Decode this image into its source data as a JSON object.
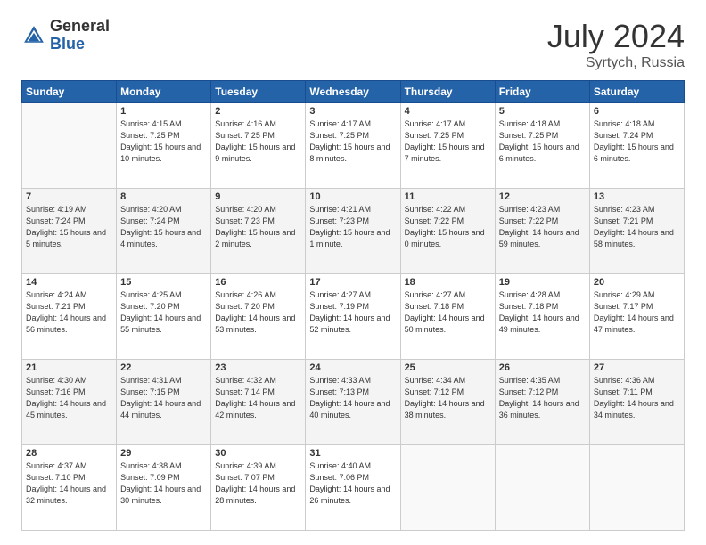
{
  "header": {
    "logo_general": "General",
    "logo_blue": "Blue",
    "title": "July 2024",
    "location": "Syrtych, Russia"
  },
  "days_of_week": [
    "Sunday",
    "Monday",
    "Tuesday",
    "Wednesday",
    "Thursday",
    "Friday",
    "Saturday"
  ],
  "weeks": [
    [
      {
        "day": "",
        "empty": true
      },
      {
        "day": "1",
        "sunrise": "4:15 AM",
        "sunset": "7:25 PM",
        "daylight": "15 hours and 10 minutes."
      },
      {
        "day": "2",
        "sunrise": "4:16 AM",
        "sunset": "7:25 PM",
        "daylight": "15 hours and 9 minutes."
      },
      {
        "day": "3",
        "sunrise": "4:17 AM",
        "sunset": "7:25 PM",
        "daylight": "15 hours and 8 minutes."
      },
      {
        "day": "4",
        "sunrise": "4:17 AM",
        "sunset": "7:25 PM",
        "daylight": "15 hours and 7 minutes."
      },
      {
        "day": "5",
        "sunrise": "4:18 AM",
        "sunset": "7:25 PM",
        "daylight": "15 hours and 6 minutes."
      },
      {
        "day": "6",
        "sunrise": "4:18 AM",
        "sunset": "7:24 PM",
        "daylight": "15 hours and 6 minutes."
      }
    ],
    [
      {
        "day": "7",
        "sunrise": "4:19 AM",
        "sunset": "7:24 PM",
        "daylight": "15 hours and 5 minutes."
      },
      {
        "day": "8",
        "sunrise": "4:20 AM",
        "sunset": "7:24 PM",
        "daylight": "15 hours and 4 minutes."
      },
      {
        "day": "9",
        "sunrise": "4:20 AM",
        "sunset": "7:23 PM",
        "daylight": "15 hours and 2 minutes."
      },
      {
        "day": "10",
        "sunrise": "4:21 AM",
        "sunset": "7:23 PM",
        "daylight": "15 hours and 1 minute."
      },
      {
        "day": "11",
        "sunrise": "4:22 AM",
        "sunset": "7:22 PM",
        "daylight": "15 hours and 0 minutes."
      },
      {
        "day": "12",
        "sunrise": "4:23 AM",
        "sunset": "7:22 PM",
        "daylight": "14 hours and 59 minutes."
      },
      {
        "day": "13",
        "sunrise": "4:23 AM",
        "sunset": "7:21 PM",
        "daylight": "14 hours and 58 minutes."
      }
    ],
    [
      {
        "day": "14",
        "sunrise": "4:24 AM",
        "sunset": "7:21 PM",
        "daylight": "14 hours and 56 minutes."
      },
      {
        "day": "15",
        "sunrise": "4:25 AM",
        "sunset": "7:20 PM",
        "daylight": "14 hours and 55 minutes."
      },
      {
        "day": "16",
        "sunrise": "4:26 AM",
        "sunset": "7:20 PM",
        "daylight": "14 hours and 53 minutes."
      },
      {
        "day": "17",
        "sunrise": "4:27 AM",
        "sunset": "7:19 PM",
        "daylight": "14 hours and 52 minutes."
      },
      {
        "day": "18",
        "sunrise": "4:27 AM",
        "sunset": "7:18 PM",
        "daylight": "14 hours and 50 minutes."
      },
      {
        "day": "19",
        "sunrise": "4:28 AM",
        "sunset": "7:18 PM",
        "daylight": "14 hours and 49 minutes."
      },
      {
        "day": "20",
        "sunrise": "4:29 AM",
        "sunset": "7:17 PM",
        "daylight": "14 hours and 47 minutes."
      }
    ],
    [
      {
        "day": "21",
        "sunrise": "4:30 AM",
        "sunset": "7:16 PM",
        "daylight": "14 hours and 45 minutes."
      },
      {
        "day": "22",
        "sunrise": "4:31 AM",
        "sunset": "7:15 PM",
        "daylight": "14 hours and 44 minutes."
      },
      {
        "day": "23",
        "sunrise": "4:32 AM",
        "sunset": "7:14 PM",
        "daylight": "14 hours and 42 minutes."
      },
      {
        "day": "24",
        "sunrise": "4:33 AM",
        "sunset": "7:13 PM",
        "daylight": "14 hours and 40 minutes."
      },
      {
        "day": "25",
        "sunrise": "4:34 AM",
        "sunset": "7:12 PM",
        "daylight": "14 hours and 38 minutes."
      },
      {
        "day": "26",
        "sunrise": "4:35 AM",
        "sunset": "7:12 PM",
        "daylight": "14 hours and 36 minutes."
      },
      {
        "day": "27",
        "sunrise": "4:36 AM",
        "sunset": "7:11 PM",
        "daylight": "14 hours and 34 minutes."
      }
    ],
    [
      {
        "day": "28",
        "sunrise": "4:37 AM",
        "sunset": "7:10 PM",
        "daylight": "14 hours and 32 minutes."
      },
      {
        "day": "29",
        "sunrise": "4:38 AM",
        "sunset": "7:09 PM",
        "daylight": "14 hours and 30 minutes."
      },
      {
        "day": "30",
        "sunrise": "4:39 AM",
        "sunset": "7:07 PM",
        "daylight": "14 hours and 28 minutes."
      },
      {
        "day": "31",
        "sunrise": "4:40 AM",
        "sunset": "7:06 PM",
        "daylight": "14 hours and 26 minutes."
      },
      {
        "day": "",
        "empty": true
      },
      {
        "day": "",
        "empty": true
      },
      {
        "day": "",
        "empty": true
      }
    ]
  ],
  "labels": {
    "sunrise": "Sunrise:",
    "sunset": "Sunset:",
    "daylight": "Daylight:"
  }
}
